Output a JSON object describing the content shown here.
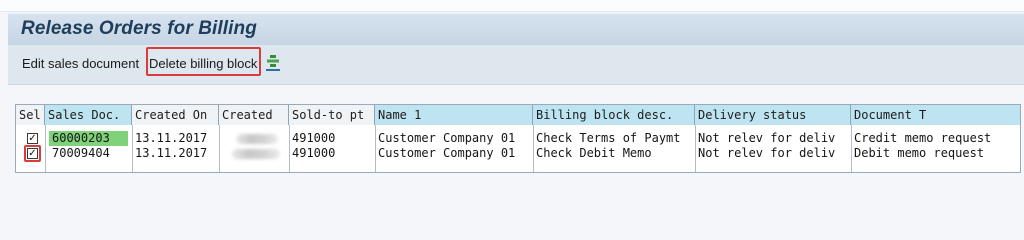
{
  "page": {
    "title": "Release Orders for Billing"
  },
  "toolbar": {
    "edit_label": "Edit sales document",
    "delete_label": "Delete billing block",
    "icon": "align-icon"
  },
  "grid": {
    "columns": [
      "Sel",
      "Sales Doc.",
      "Created On",
      "Created",
      "Sold-to pt",
      "Name 1",
      "Billing block desc.",
      "Delivery status",
      "Document T"
    ],
    "rows": [
      {
        "selected": true,
        "sales_doc": "60000203",
        "created_on": "13.11.2017",
        "sold_to": "491000",
        "name": "Customer Company 01",
        "billing_block": "Check Terms of Paymt",
        "delivery_status": "Not relev for deliv",
        "doc_type": "Credit memo request"
      },
      {
        "selected": true,
        "sales_doc": "70009404",
        "created_on": "13.11.2017",
        "sold_to": "491000",
        "name": "Customer Company 01",
        "billing_block": "Check Debit Memo",
        "delivery_status": "Not relev for deliv",
        "doc_type": "Debit memo request"
      }
    ]
  },
  "colors": {
    "accent": "#d93c3c",
    "highlight": "#7fd17a",
    "header_cyan": "#bfe4f1"
  }
}
